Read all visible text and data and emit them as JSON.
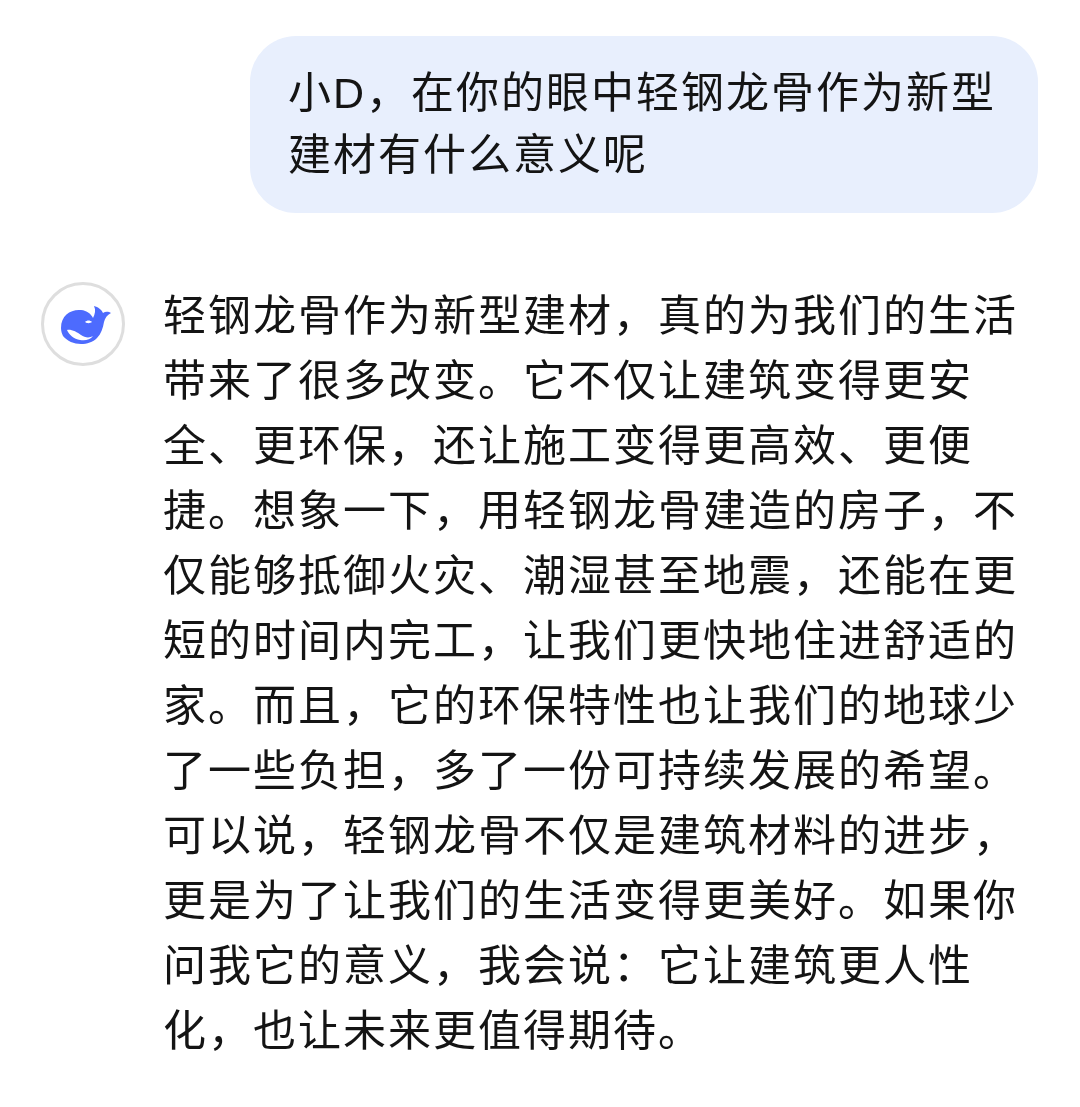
{
  "user_message": {
    "text": "小D，在你的眼中轻钢龙骨作为新型建材有什么意义呢"
  },
  "assistant_message": {
    "text": "轻钢龙骨作为新型建材，真的为我们的生活带来了很多改变。它不仅让建筑变得更安全、更环保，还让施工变得更高效、更便捷。想象一下，用轻钢龙骨建造的房子，不仅能够抵御火灾、潮湿甚至地震，还能在更短的时间内完工，让我们更快地住进舒适的家。而且，它的环保特性也让我们的地球少了一些负担，多了一份可持续发展的希望。可以说，轻钢龙骨不仅是建筑材料的进步，更是为了让我们的生活变得更美好。如果你问我它的意义，我会说：它让建筑更人性化，也让未来更值得期待。"
  }
}
